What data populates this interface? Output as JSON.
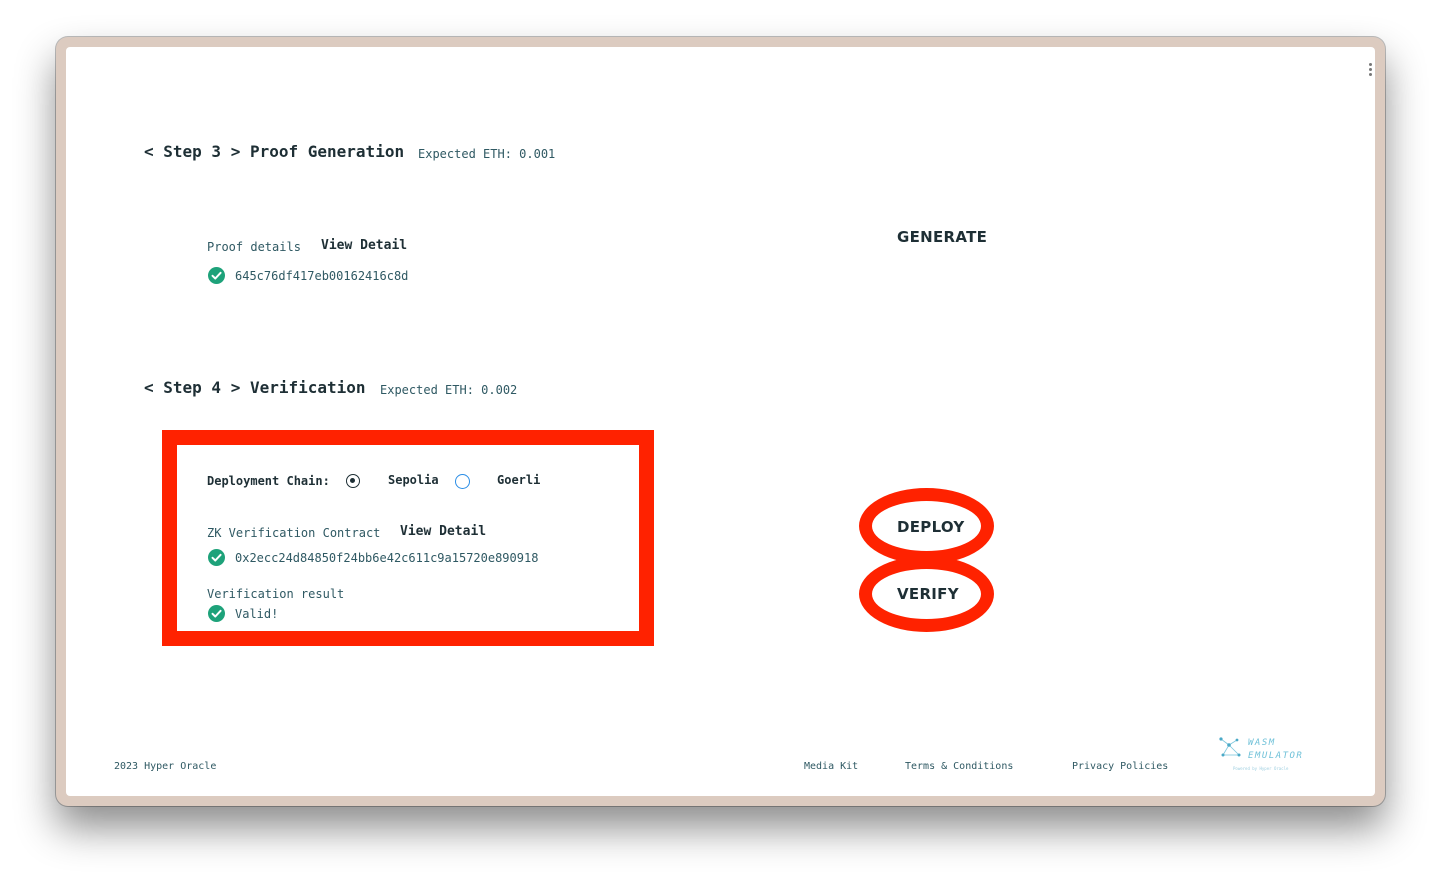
{
  "step3": {
    "title": "< Step 3 > Proof Generation",
    "expected": "Expected ETH: 0.001",
    "proof_label": "Proof details",
    "view_detail": "View Detail",
    "proof_hash": "645c76df417eb00162416c8d",
    "action": "GENERATE"
  },
  "step4": {
    "title": "< Step 4 > Verification",
    "expected": "Expected ETH: 0.002",
    "chain_label": "Deployment Chain:",
    "chain_options": [
      "Sepolia",
      "Goerli"
    ],
    "selected_chain": "Sepolia",
    "contract_label": "ZK Verification Contract",
    "view_detail": "View Detail",
    "contract_address": "0x2ecc24d84850f24bb6e42c611c9a15720e890918",
    "result_label": "Verification result",
    "result_value": "Valid!",
    "deploy_action": "DEPLOY",
    "verify_action": "VERIFY"
  },
  "footer": {
    "copyright": "2023 Hyper Oracle",
    "links": [
      "Media Kit",
      "Terms & Conditions",
      "Privacy Policies"
    ],
    "logo_line1": "WASM",
    "logo_line2": "EMULATOR",
    "logo_sub": "Powered by Hyper Oracle"
  },
  "colors": {
    "annotation": "#ff2200",
    "text_dark": "#1e2f35",
    "text_teal": "#2f5963",
    "check_green": "#1ea27a",
    "radio_blue": "#2a8de6"
  }
}
